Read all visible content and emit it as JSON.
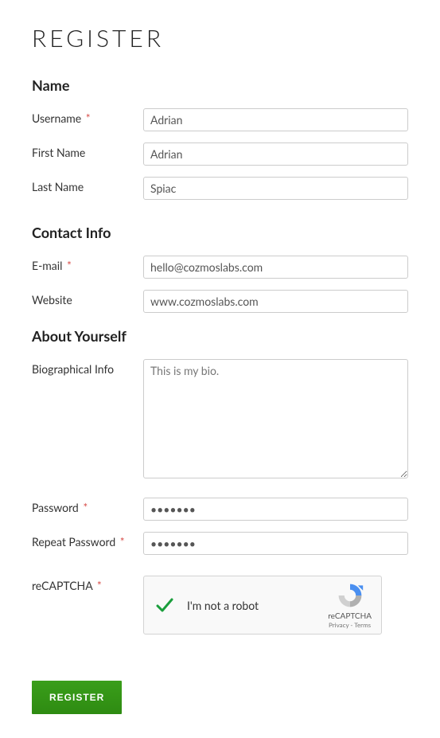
{
  "page_title": "REGISTER",
  "sections": {
    "name": {
      "title": "Name",
      "fields": {
        "username": {
          "label": "Username",
          "required": true,
          "value": "Adrian"
        },
        "first_name": {
          "label": "First Name",
          "required": false,
          "value": "Adrian"
        },
        "last_name": {
          "label": "Last Name",
          "required": false,
          "value": "Spiac"
        }
      }
    },
    "contact": {
      "title": "Contact Info",
      "fields": {
        "email": {
          "label": "E-mail",
          "required": true,
          "value": "hello@cozmoslabs.com"
        },
        "website": {
          "label": "Website",
          "required": false,
          "value": "www.cozmoslabs.com"
        }
      }
    },
    "about": {
      "title": "About Yourself",
      "fields": {
        "bio": {
          "label": "Biographical Info",
          "required": false,
          "value": "This is my bio."
        },
        "password": {
          "label": "Password",
          "required": true,
          "value": "•••••••"
        },
        "repeat_password": {
          "label": "Repeat Password",
          "required": true,
          "value": "•••••••"
        },
        "recaptcha": {
          "label": "reCAPTCHA",
          "required": true
        }
      }
    }
  },
  "recaptcha": {
    "text": "I'm not a robot",
    "brand": "reCAPTCHA",
    "links": "Privacy - Terms",
    "checked": true
  },
  "submit_label": "REGISTER",
  "required_marker": "*"
}
